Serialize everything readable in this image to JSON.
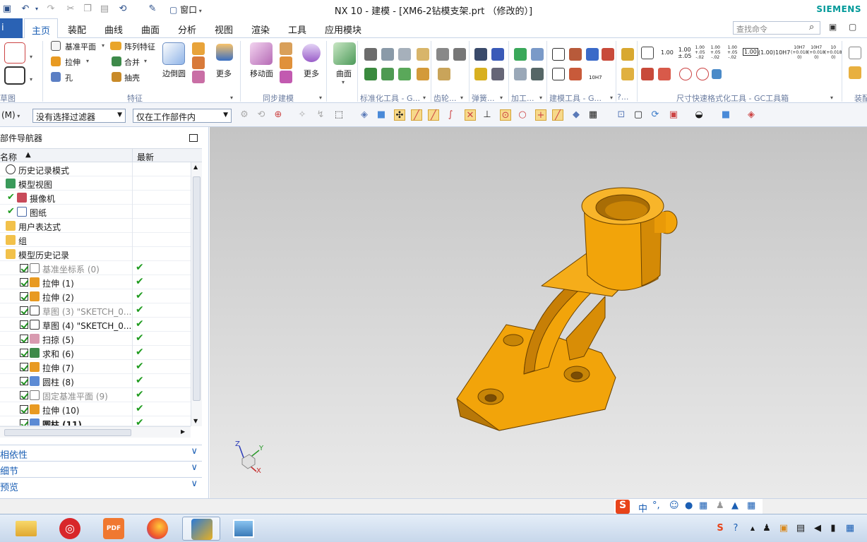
{
  "titlebar": {
    "title": "NX 10 - 建模 - [XM6-2钻模支架.prt （修改的）]",
    "brand": "SIEMENS",
    "window_menu": "窗口"
  },
  "menu": {
    "file_tab": "ⅰ",
    "tabs": [
      "主页",
      "装配",
      "曲线",
      "曲面",
      "分析",
      "视图",
      "渲染",
      "工具",
      "应用模块"
    ],
    "active_tab": "主页",
    "search_placeholder": "查找命令"
  },
  "ribbon": {
    "features": {
      "datum_plane": "基准平面",
      "pattern_feature": "阵列特征",
      "extrude": "拉伸",
      "unite": "合并",
      "hole": "孔",
      "shell": "抽壳",
      "edge_blend": "边倒圆",
      "more": "更多"
    },
    "sync": {
      "move_face": "移动面",
      "more": "更多"
    },
    "surface": "曲面",
    "groups": {
      "sketch": "草图",
      "feature": "特征",
      "sync_modeling": "同步建模",
      "standard_tools": "标准化工具 - G...",
      "gear": "齿轮...",
      "spring": "弹簧...",
      "machining": "加工...",
      "modeling_tools": "建模工具 - G...",
      "other": "?...",
      "dimension_tools": "尺寸快速格式化工具 - GC工具箱",
      "assembly": "装配"
    },
    "tolerance_buttons": [
      "1.00",
      "1.00\n±.05",
      "1.00\n+.05\n-.02",
      "1.00\n+.05\n-.02",
      "1.00\n+.05\n-.02",
      "1.00",
      "(1.00)",
      "10H7",
      "10H7\n(+0.018\n0)",
      "10H7\n(+0.018\n0)",
      "10\n(+0.018\n0)"
    ],
    "hole_callout": "10H7"
  },
  "selection_bar": {
    "mode": "(M)",
    "filter": "没有选择过滤器",
    "scope": "仅在工作部件内"
  },
  "navigator": {
    "title": "部件导航器",
    "col_name": "名称",
    "col_latest": "最新",
    "rows": [
      {
        "label": "历史记录模式"
      },
      {
        "label": "模型视图"
      },
      {
        "label": "摄像机"
      },
      {
        "label": "图纸"
      },
      {
        "label": "用户表达式"
      },
      {
        "label": "组"
      },
      {
        "label": "模型历史记录"
      },
      {
        "label": "基准坐标系 (0)"
      },
      {
        "label": "拉伸 (1)"
      },
      {
        "label": "拉伸 (2)"
      },
      {
        "label": "草图 (3) \"SKETCH_0..."
      },
      {
        "label": "草图 (4) \"SKETCH_0..."
      },
      {
        "label": "扫掠 (5)"
      },
      {
        "label": "求和 (6)"
      },
      {
        "label": "拉伸 (7)"
      },
      {
        "label": "圆柱 (8)"
      },
      {
        "label": "固定基准平面 (9)"
      },
      {
        "label": "拉伸 (10)"
      },
      {
        "label": "圆柱 (11)"
      }
    ],
    "panels": [
      "相依性",
      "细节",
      "预览"
    ]
  },
  "viewport": {
    "axis_x": "X",
    "axis_y": "Y",
    "axis_z": "Z",
    "part_color": "#f2a40a"
  },
  "ime": {
    "mode": "中"
  },
  "taskbar": {
    "apps": [
      "file-explorer",
      "netease-music",
      "pdf-reader",
      "firefox",
      "nx",
      "image-viewer"
    ]
  }
}
